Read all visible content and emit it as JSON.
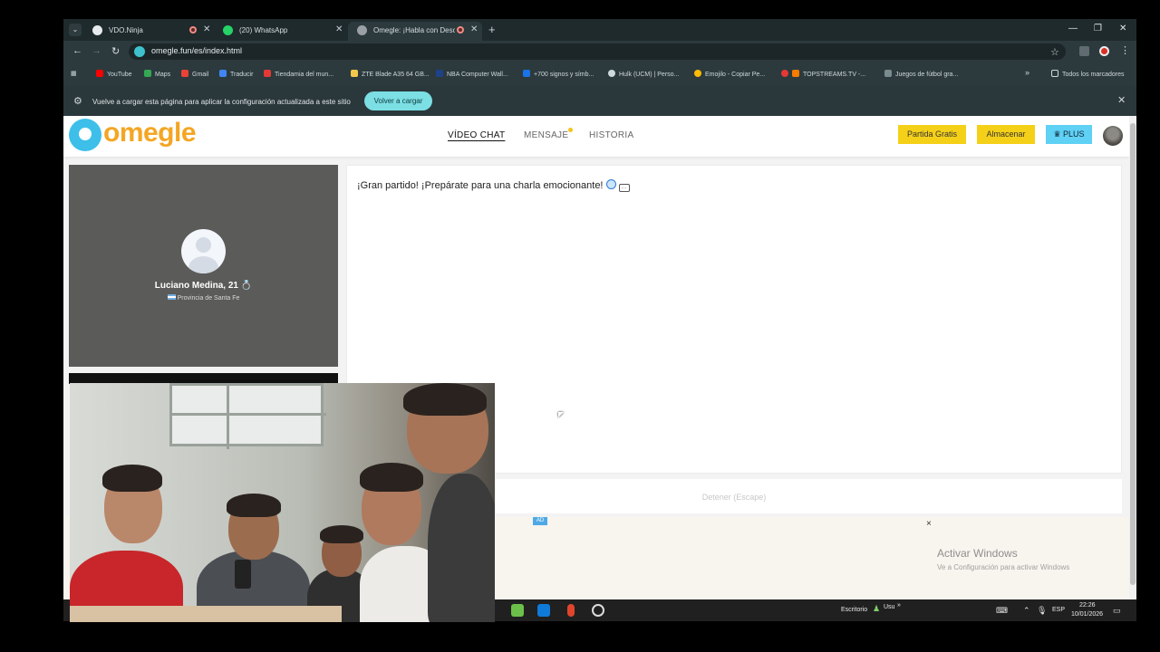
{
  "browser": {
    "tabs": [
      {
        "title": "VDO.Ninja",
        "active": false,
        "recording": true
      },
      {
        "title": "(20) WhatsApp",
        "active": false,
        "recording": false
      },
      {
        "title": "Omegle: ¡Habla con Descon",
        "active": true,
        "recording": true
      }
    ],
    "url": "omegle.fun/es/index.html",
    "bookmarks": [
      "YouTube",
      "Maps",
      "Gmail",
      "Traducir",
      "Tiendamia del mun...",
      "ZTE Blade A35 64 GB...",
      "NBA Computer Wall...",
      "+700 signos y símb...",
      "Hulk (UCM) | Perso...",
      "Emojilo - Copiar Pe...",
      "TOPSTREAMS.TV -...",
      "Juegos de fútbol gra..."
    ],
    "bookmarks_overflow": "»",
    "all_bookmarks": "Todos los marcadores",
    "infobar": {
      "text": "Vuelve a cargar esta página para aplicar la configuración actualizada a este sitio",
      "button": "Volver a cargar"
    }
  },
  "site": {
    "logo_text": "omegle",
    "nav": [
      {
        "label": "VÍDEO CHAT",
        "active": true
      },
      {
        "label": "MENSAJE",
        "active": false,
        "has_dot": true
      },
      {
        "label": "HISTORIA",
        "active": false
      }
    ],
    "buttons": {
      "free_match": "Partida Gratis",
      "store": "Almacenar",
      "plus": "PLUS"
    }
  },
  "profile": {
    "name": "Luciano Medina, 21",
    "location": "Provincia de Santa Fe"
  },
  "chat": {
    "message": "¡Gran partido! ¡Prepárate para una charla emocionante!",
    "stop_label": "Detener (Escape)"
  },
  "ad": {
    "badge": "AD",
    "close": "×"
  },
  "watermark": {
    "title": "Activar Windows",
    "subtitle": "Ve a Configuración para activar Windows"
  },
  "taskbar": {
    "desktop_label": "Escritorio",
    "user_label": "Usu",
    "language": "ESP",
    "time": "22:26",
    "date": "10/01/2026"
  },
  "colors": {
    "brand_orange": "#f4a623",
    "brand_blue": "#3dbfe9",
    "button_yellow": "#f5d018",
    "plus_blue": "#5fd1f5",
    "reload_button": "#7bdfe4"
  }
}
